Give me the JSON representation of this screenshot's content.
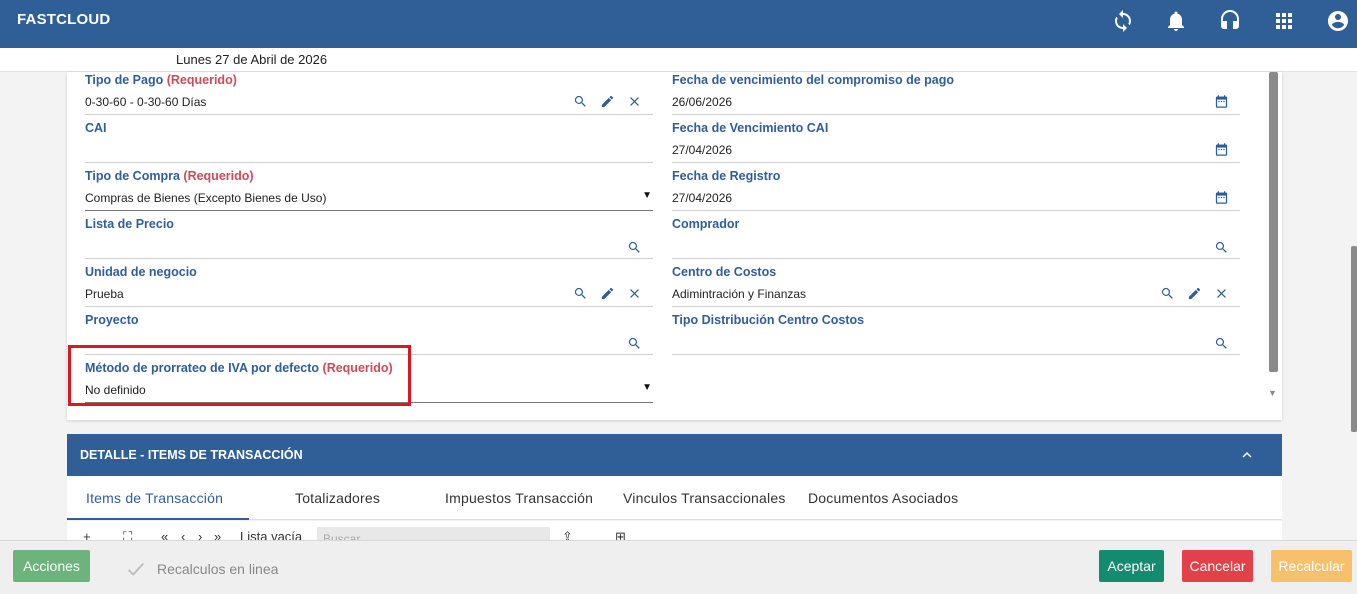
{
  "header": {
    "brand": "FASTCLOUD",
    "icons": [
      "refresh-icon",
      "bell-icon",
      "headset-icon",
      "apps-grid-icon",
      "account-icon"
    ]
  },
  "date_label": "Lunes 27 de Abril de 2026",
  "form": {
    "tipo_pago": {
      "label": "Tipo de Pago",
      "required": "(Requerido)",
      "value": "0-30-60 - 0-30-60 Días"
    },
    "cai": {
      "label": "CAI",
      "value": ""
    },
    "tipo_compra": {
      "label": "Tipo de Compra",
      "required": "(Requerido)",
      "value": "Compras de Bienes (Excepto Bienes de Uso)"
    },
    "lista_precio": {
      "label": "Lista de Precio",
      "value": ""
    },
    "unidad_negocio": {
      "label": "Unidad de negocio",
      "value": "Prueba"
    },
    "proyecto": {
      "label": "Proyecto",
      "value": ""
    },
    "metodo_iva": {
      "label": "Método de prorrateo de IVA por defecto",
      "required": "(Requerido)",
      "value": "No definido"
    },
    "fecha_venc_pago": {
      "label": "Fecha de vencimiento del compromiso de pago",
      "value": "26/06/2026"
    },
    "fecha_venc_cai": {
      "label": "Fecha de Vencimiento CAI",
      "value": "27/04/2026"
    },
    "fecha_registro": {
      "label": "Fecha de Registro",
      "value": "27/04/2026"
    },
    "comprador": {
      "label": "Comprador",
      "value": ""
    },
    "centro_costos": {
      "label": "Centro de Costos",
      "value": "Adimintración y Finanzas"
    },
    "tipo_dist": {
      "label": "Tipo Distribución Centro Costos",
      "value": ""
    }
  },
  "detail": {
    "title": "DETALLE - ITEMS DE TRANSACCIÓN",
    "tabs": [
      "Items de Transacción",
      "Totalizadores",
      "Impuestos Transacción",
      "Vinculos Transaccionales",
      "Documentos Asociados"
    ],
    "active_tab": 0,
    "toolbar": {
      "add": "+",
      "expand": "⛶",
      "first": "«",
      "prev": "‹",
      "next": "›",
      "last": "»",
      "empty_label": "Lista vacía",
      "search_placeholder": "Buscar"
    }
  },
  "actions": {
    "acciones": "Acciones",
    "recalc_online": "Recalculos en linea",
    "aceptar": "Aceptar",
    "cancelar": "Cancelar",
    "recalcular": "Recalcular"
  },
  "colors": {
    "primary": "#2f5f96",
    "required": "#d04a5a",
    "accept": "#128b6e",
    "cancel": "#e2404a",
    "recalc": "#f7c16c",
    "actions": "#6cb37c",
    "highlight": "#d9191c"
  }
}
